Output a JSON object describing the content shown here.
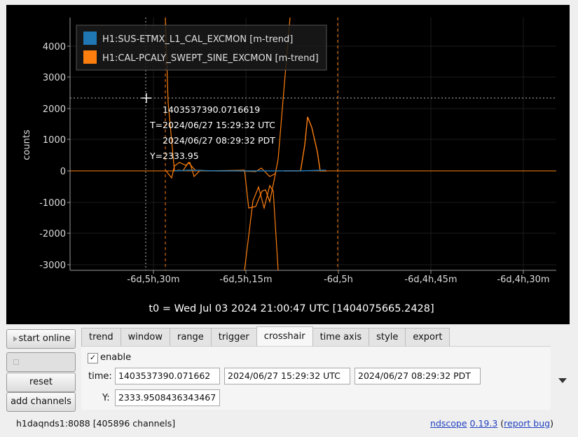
{
  "plot": {
    "y_axis_label": "counts",
    "y_ticks": [
      "4000",
      "3000",
      "2000",
      "1000",
      "0",
      "-1000",
      "-2000",
      "-3000"
    ],
    "x_ticks": [
      "-6d,5h,30m",
      "-6d,5h,15m",
      "-6d,5h",
      "-6d,4h,45m",
      "-6d,4h,30m"
    ],
    "t0_label": "t0 = Wed Jul 03 2024 21:00:47 UTC [1404075665.2428]",
    "legend": [
      {
        "name": "H1:SUS-ETMX_L1_CAL_EXCMON [m-trend]",
        "color": "#1f77b4"
      },
      {
        "name": "H1:CAL-PCALY_SWEPT_SINE_EXCMON [m-trend]",
        "color": "#ff7f0e"
      }
    ],
    "crosshair": {
      "gps": "1403537390.0716619",
      "t_prefix": "T=",
      "utc": "2024/06/27 15:29:32 UTC",
      "pdt": "2024/06/27 08:29:32 PDT",
      "y_prefix": "Y=",
      "y": "2333.95"
    }
  },
  "sidebar": {
    "start_online": "start online",
    "disabled_button": "",
    "reset": "reset",
    "add_channels": "add channels"
  },
  "tabs": [
    "trend",
    "window",
    "range",
    "trigger",
    "crosshair",
    "time axis",
    "style",
    "export"
  ],
  "active_tab": "crosshair",
  "crosshair_panel": {
    "enable_label": "enable",
    "enable_checked": true,
    "time_label": "time:",
    "time_gps": "1403537390.071662",
    "time_utc": "2024/06/27 15:29:32 UTC",
    "time_pdt": "2024/06/27 08:29:32 PDT",
    "y_label": "Y:",
    "y_value": "2333.9508436343467"
  },
  "status": {
    "server": "h1daqnds1:8088  [405896 channels]",
    "app": "ndscope",
    "version": "0.19.3",
    "report_prefix": "(",
    "report_bug": "report bug",
    "report_suffix": ")"
  }
}
